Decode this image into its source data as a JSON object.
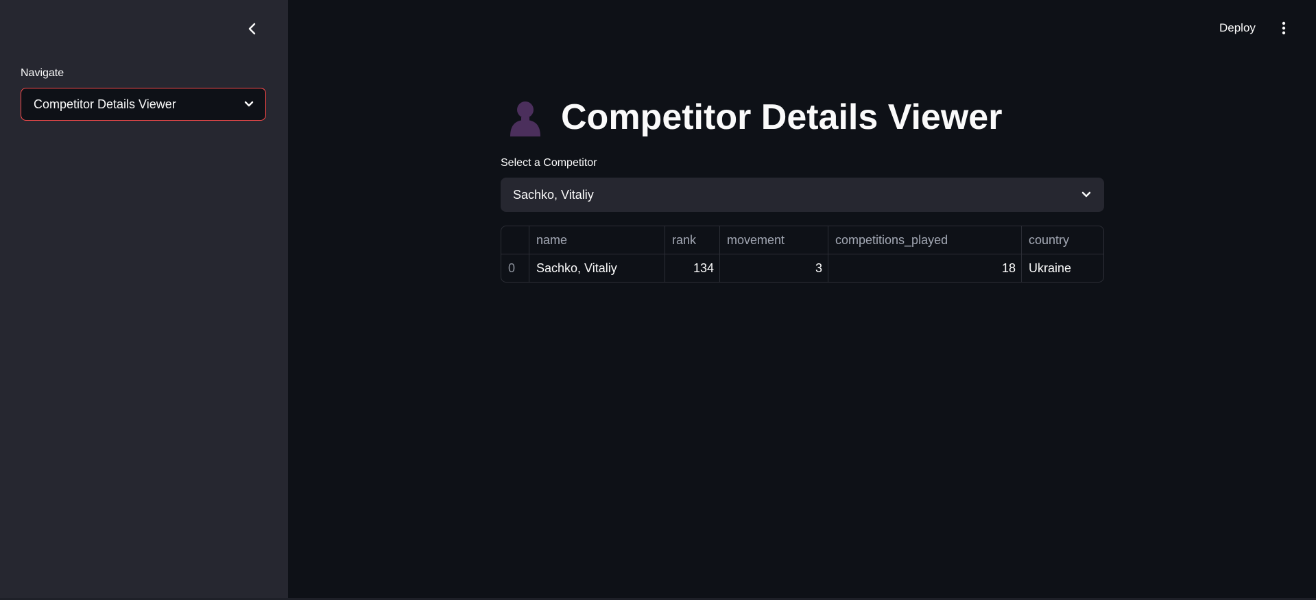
{
  "sidebar": {
    "nav_label": "Navigate",
    "nav_selected": "Competitor Details Viewer"
  },
  "header": {
    "deploy_label": "Deploy"
  },
  "main": {
    "title": "Competitor Details Viewer",
    "title_icon": "person-icon",
    "select_label": "Select a Competitor",
    "select_value": "Sachko, Vitaliy",
    "table": {
      "columns": [
        "",
        "name",
        "rank",
        "movement",
        "competitions_played",
        "country"
      ],
      "rows": [
        {
          "index": "0",
          "name": "Sachko, Vitaliy",
          "rank": "134",
          "movement": "3",
          "competitions_played": "18",
          "country": "Ukraine"
        }
      ]
    }
  },
  "colors": {
    "background": "#0e1117",
    "sidebar": "#262730",
    "accent": "#ff4b4b",
    "icon": "#4b2f5c"
  }
}
